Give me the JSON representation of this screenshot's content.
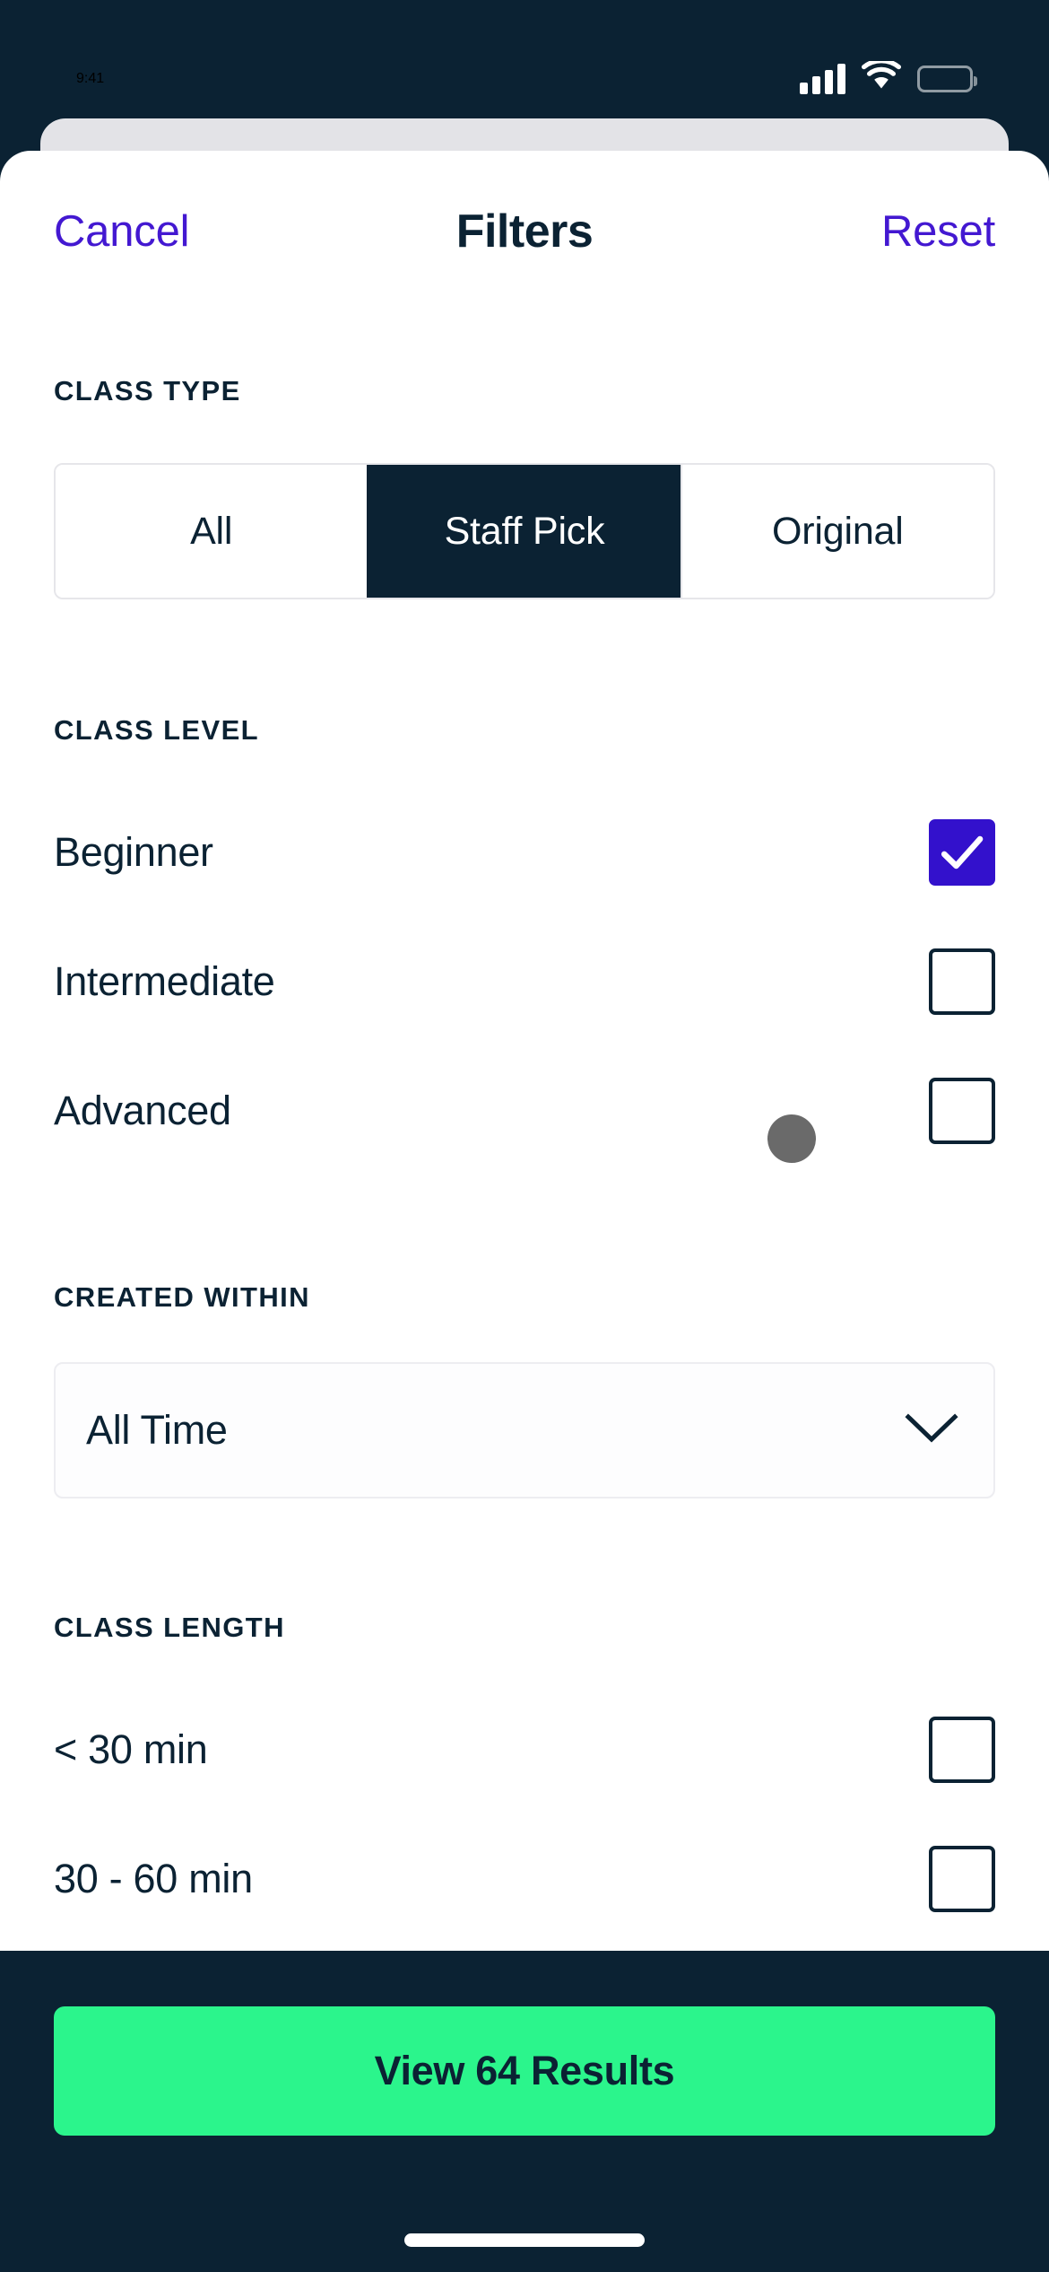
{
  "status_bar": {
    "time": "9:41",
    "icons": [
      "cellular-signal-icon",
      "wifi-icon",
      "battery-icon"
    ]
  },
  "colors": {
    "brand_dark": "#0b2233",
    "accent_purple": "#4318d1",
    "checkbox_checked": "#3311cc",
    "cta_green": "#2bf58c",
    "sheet_behind": "#e3e3e7",
    "touch_indicator": "#6a6a6a"
  },
  "header": {
    "cancel_label": "Cancel",
    "title": "Filters",
    "reset_label": "Reset"
  },
  "sections": {
    "class_type": {
      "label": "CLASS TYPE",
      "options": [
        {
          "label": "All",
          "selected": false
        },
        {
          "label": "Staff Pick",
          "selected": true
        },
        {
          "label": "Original",
          "selected": false
        }
      ]
    },
    "class_level": {
      "label": "CLASS LEVEL",
      "items": [
        {
          "label": "Beginner",
          "checked": true
        },
        {
          "label": "Intermediate",
          "checked": false
        },
        {
          "label": "Advanced",
          "checked": false
        }
      ]
    },
    "created_within": {
      "label": "CREATED WITHIN",
      "value": "All Time",
      "chevron": "chevron-down-icon"
    },
    "class_length": {
      "label": "CLASS LENGTH",
      "items": [
        {
          "label": "< 30 min",
          "checked": false
        },
        {
          "label": "30 - 60 min",
          "checked": false
        }
      ]
    }
  },
  "footer": {
    "view_results_label": "View 64 Results",
    "result_count": "64"
  }
}
